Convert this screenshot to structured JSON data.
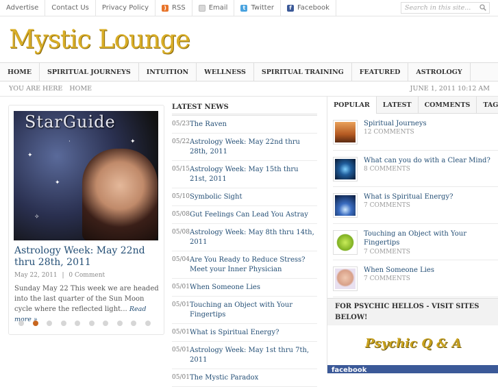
{
  "topbar": {
    "links": [
      {
        "label": "Advertise",
        "icon": ""
      },
      {
        "label": "Contact Us",
        "icon": ""
      },
      {
        "label": "Privacy Policy",
        "icon": ""
      },
      {
        "label": "RSS",
        "icon": "rss-icon",
        "color": "#e8742a"
      },
      {
        "label": "Email",
        "icon": "email-icon",
        "color": "#cccccc"
      },
      {
        "label": "Twitter",
        "icon": "twitter-icon",
        "color": "#4aa3df"
      },
      {
        "label": "Facebook",
        "icon": "facebook-icon",
        "color": "#3b5998"
      }
    ],
    "search_placeholder": "Search in this site..."
  },
  "site": {
    "logo": "Mystic Lounge",
    "logo_color": "#d9ae27"
  },
  "nav": [
    "HOME",
    "SPIRITUAL JOURNEYS",
    "INTUITION",
    "WELLNESS",
    "SPIRITUAL TRAINING",
    "FEATURED",
    "ASTROLOGY"
  ],
  "breadcrumb": {
    "label": "YOU ARE HERE",
    "current": "HOME",
    "datetime": "JUNE 1, 2011 10:12 AM"
  },
  "featured": {
    "image_text": "StarGuide",
    "title": "Astrology Week: May 22nd thru 28th, 2011",
    "date": "May 22, 2011",
    "sep": "|",
    "comments": "0 Comment",
    "excerpt": "Sunday May 22 This week we are headed into the last quarter of the Sun Moon cycle where the reflected light...",
    "read_more": "Read more »",
    "slides": 10,
    "active_slide": 2,
    "accent": "#c8661f"
  },
  "latest_news": {
    "heading": "LATEST NEWS",
    "items": [
      {
        "date": "05/23",
        "title": "The Raven"
      },
      {
        "date": "05/22",
        "title": "Astrology Week: May 22nd thru 28th, 2011"
      },
      {
        "date": "05/15",
        "title": "Astrology Week: May 15th thru 21st, 2011"
      },
      {
        "date": "05/10",
        "title": "Symbolic Sight"
      },
      {
        "date": "05/08",
        "title": "Gut Feelings Can Lead You Astray"
      },
      {
        "date": "05/08",
        "title": "Astrology Week: May 8th thru 14th, 2011"
      },
      {
        "date": "05/04",
        "title": "Are You Ready to Reduce Stress? Meet your Inner Physician"
      },
      {
        "date": "05/01",
        "title": "When Someone Lies"
      },
      {
        "date": "05/01",
        "title": "Touching an Object with Your Fingertips"
      },
      {
        "date": "05/01",
        "title": "What is Spiritual Energy?"
      },
      {
        "date": "05/01",
        "title": "Astrology Week: May 1st thru 7th, 2011"
      },
      {
        "date": "05/01",
        "title": "The Mystic Paradox"
      }
    ]
  },
  "sidebar": {
    "tabs": [
      "POPULAR",
      "LATEST",
      "COMMENTS",
      "TAGS"
    ],
    "active_tab": "POPULAR",
    "popular": [
      {
        "title": "Spiritual Journeys",
        "comments": "12 COMMENTS"
      },
      {
        "title": "What can you do with a Clear Mind?",
        "comments": "8 COMMENTS"
      },
      {
        "title": "What is Spiritual Energy?",
        "comments": "7 COMMENTS"
      },
      {
        "title": "Touching an Object with Your Fingertips",
        "comments": "7 COMMENTS"
      },
      {
        "title": "When Someone Lies",
        "comments": "7 COMMENTS"
      }
    ],
    "psychic_heading": "FOR PSYCHIC HELLOS - VISIT SITES BELOW!",
    "psychic_logo": "Psychic Q & A",
    "facebook_label": "facebook"
  },
  "colors": {
    "link": "#234e75",
    "text": "#555555"
  }
}
